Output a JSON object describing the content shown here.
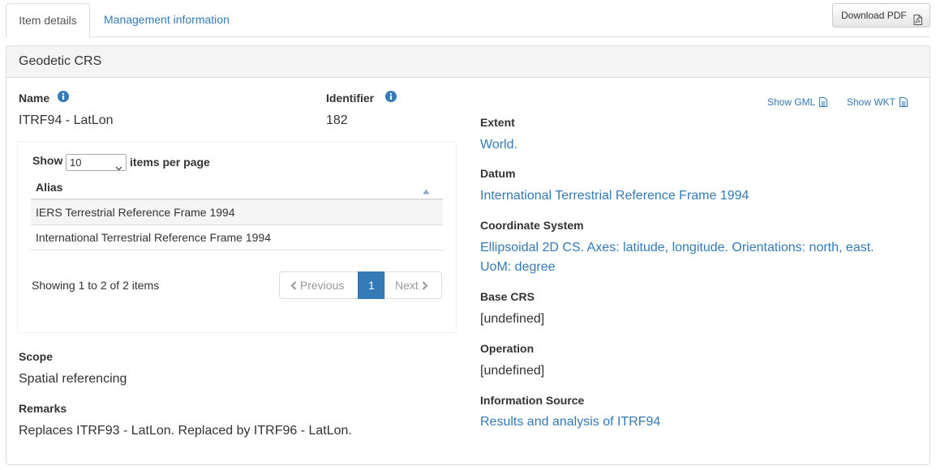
{
  "tabs": {
    "item_details": "Item details",
    "management_info": "Management information"
  },
  "download_pdf": "Download PDF",
  "panel": {
    "title": "Geodetic CRS"
  },
  "left": {
    "name_label": "Name",
    "name_value": "ITRF94 - LatLon",
    "identifier_label": "Identifier",
    "identifier_value": "182",
    "scope_label": "Scope",
    "scope_value": "Spatial referencing",
    "remarks_label": "Remarks",
    "remarks_value": "Replaces ITRF93 - LatLon. Replaced by ITRF96 - LatLon."
  },
  "alias_table": {
    "show_label": "Show",
    "page_size": "10",
    "per_page_label": "items per page",
    "column_header": "Alias",
    "rows": [
      "IERS Terrestrial Reference Frame 1994",
      "International Terrestrial Reference Frame 1994"
    ],
    "showing_text": "Showing 1 to 2 of 2 items",
    "pager": {
      "previous": "Previous",
      "current": "1",
      "next": "Next"
    }
  },
  "right": {
    "show_gml": "Show GML",
    "show_wkt": "Show WKT",
    "extent_label": "Extent",
    "extent_value": "World.",
    "datum_label": "Datum",
    "datum_value": "International Terrestrial Reference Frame 1994",
    "cs_label": "Coordinate System",
    "cs_value_line1": "Ellipsoidal 2D CS. Axes: latitude, longitude. Orientations: north, east.",
    "cs_value_line2": "UoM: degree",
    "base_crs_label": "Base CRS",
    "base_crs_value": "[undefined]",
    "operation_label": "Operation",
    "operation_value": "[undefined]",
    "info_source_label": "Information Source",
    "info_source_value": "Results and analysis of ITRF94"
  },
  "colors": {
    "link": "#337ab7",
    "active_page": "#337ab7",
    "panel_heading_bg": "#f5f5f5",
    "border": "#dddddd"
  },
  "icons": {
    "info": "info-circle-icon",
    "document": "document-icon",
    "pdf": "pdf-file-icon",
    "sort": "sort-ascending-icon",
    "chevron_left": "chevron-left-icon",
    "chevron_right": "chevron-right-icon",
    "dropdown": "chevron-down-icon"
  }
}
